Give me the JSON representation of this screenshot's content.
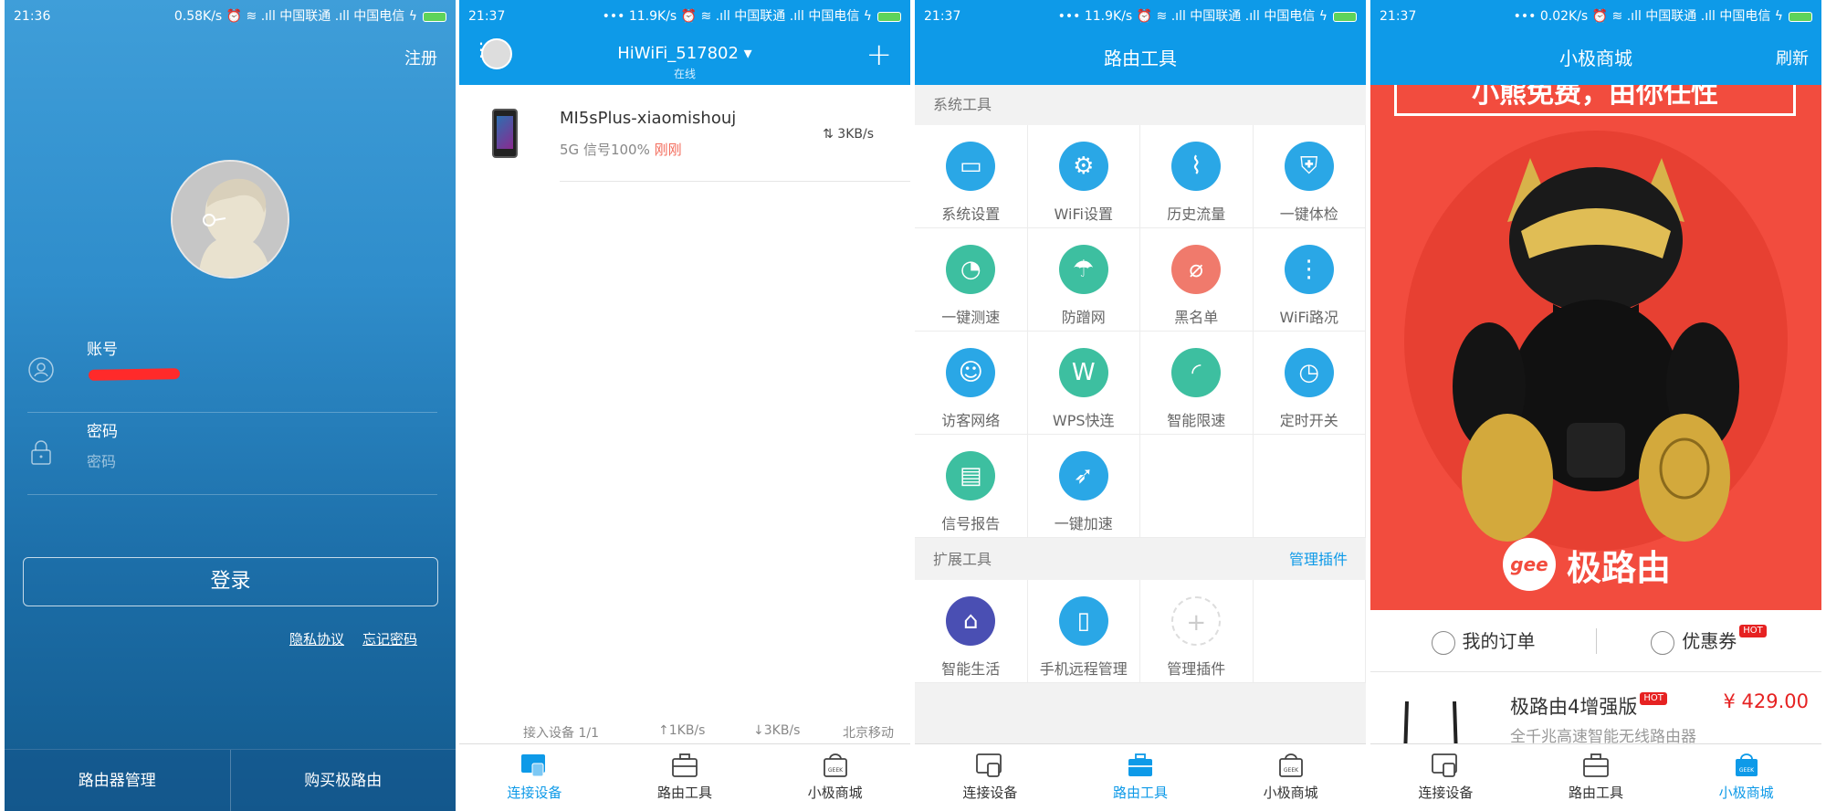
{
  "login": {
    "status": {
      "time": "21:36",
      "right": "0.58K/s ⏰ ≋ .ıll 中国联通 .ıll 中国电信 ϟ"
    },
    "register": "注册",
    "account_label": "账号",
    "password_label": "密码",
    "password_placeholder": "密码",
    "login_button": "登录",
    "privacy": "隐私协议",
    "forgot": "忘记密码",
    "footer_left": "路由器管理",
    "footer_right": "购买极路由"
  },
  "devices": {
    "status": {
      "time": "21:37",
      "right": "••• 11.9K/s ⏰ ≋ .ıll 中国联通 .ıll 中国电信 ϟ"
    },
    "title": "HiWiFi_517802 ▾",
    "subtitle": "在线",
    "device": {
      "name": "MI5sPlus-xiaomishouj",
      "band": "5G",
      "signal": "信号100%",
      "time": "刚刚",
      "speed": "⇅ 3KB/s"
    },
    "stats": {
      "count": "接入设备 1/1",
      "up": "↑1KB/s",
      "down": "↓3KB/s",
      "isp": "北京移动"
    }
  },
  "tools": {
    "status": {
      "time": "21:37",
      "right": "••• 11.9K/s ⏰ ≋ .ıll 中国联通 .ıll 中国电信 ϟ"
    },
    "title": "路由工具",
    "section_system": "系统工具",
    "system": [
      {
        "label": "系统设置",
        "color": "#2aa7e6",
        "icon": "router-icon"
      },
      {
        "label": "WiFi设置",
        "color": "#2aa7e6",
        "icon": "wifi-gear-icon"
      },
      {
        "label": "历史流量",
        "color": "#2aa7e6",
        "icon": "chart-line-icon"
      },
      {
        "label": "一键体检",
        "color": "#2aa7e6",
        "icon": "shield-check-icon"
      },
      {
        "label": "一键测速",
        "color": "#3dbfa0",
        "icon": "speedometer-icon"
      },
      {
        "label": "防蹭网",
        "color": "#3dbfa0",
        "icon": "shield-umbrella-icon"
      },
      {
        "label": "黑名单",
        "color": "#f07a6c",
        "icon": "wifi-block-icon"
      },
      {
        "label": "WiFi路况",
        "color": "#2aa7e6",
        "icon": "traffic-light-icon"
      },
      {
        "label": "访客网络",
        "color": "#2aa7e6",
        "icon": "guest-icon"
      },
      {
        "label": "WPS快连",
        "color": "#3dbfa0",
        "icon": "wps-icon"
      },
      {
        "label": "智能限速",
        "color": "#3dbfa0",
        "icon": "gauge-icon"
      },
      {
        "label": "定时开关",
        "color": "#2aa7e6",
        "icon": "timer-icon"
      },
      {
        "label": "信号报告",
        "color": "#3dbfa0",
        "icon": "report-icon"
      },
      {
        "label": "一键加速",
        "color": "#2aa7e6",
        "icon": "rocket-icon"
      }
    ],
    "section_ext": "扩展工具",
    "manage_plugins_link": "管理插件",
    "ext": [
      {
        "label": "智能生活",
        "color": "#4a4fb3",
        "icon": "smart-home-icon"
      },
      {
        "label": "手机远程管理",
        "color": "#2aa7e6",
        "icon": "phone-remote-icon"
      },
      {
        "label": "管理插件",
        "color": "#ffffff",
        "icon": "plus-icon"
      }
    ]
  },
  "store": {
    "status": {
      "time": "21:37",
      "right": "••• 0.02K/s ⏰ ≋ .ıll 中国联通 .ıll 中国电信 ϟ"
    },
    "title": "小极商城",
    "refresh": "刷新",
    "banner_top": "小熊免费，由你任性",
    "banner_brand": "极路由",
    "banner_logo": "gee",
    "my_orders": "我的订单",
    "coupons": "优惠券",
    "hot": "HOT",
    "product": {
      "name": "极路由4增强版",
      "desc": "全千兆高速智能无线路由器",
      "price": "¥ 429.00"
    }
  },
  "tabs": {
    "devices": "连接设备",
    "tools": "路由工具",
    "store": "小极商城"
  },
  "colors": {
    "accent": "#0e9ae8",
    "red": "#f24c3e"
  }
}
